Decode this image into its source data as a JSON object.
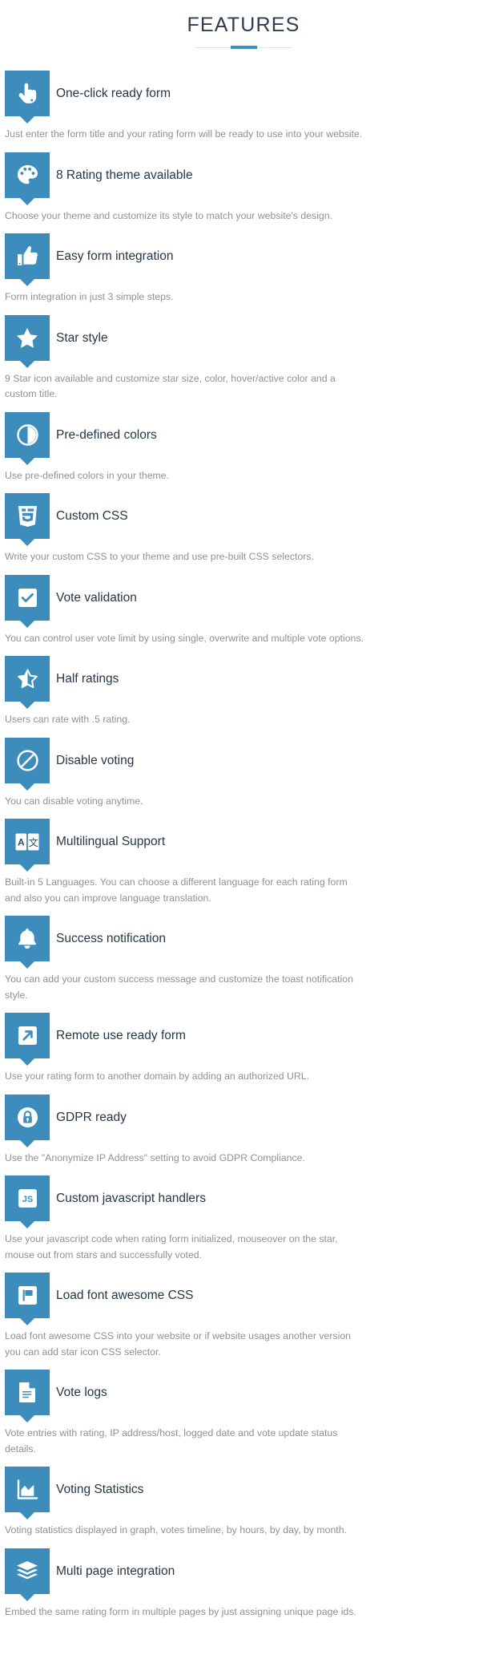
{
  "header": {
    "title": "FEATURES",
    "accent_color": "#3d8fbf",
    "divider_color": "#e2e2e2"
  },
  "theme": {
    "badge_color": "#3c8dbc",
    "title_color": "#253746",
    "description_color": "#8f9193"
  },
  "features": [
    {
      "icon": "hand-pointer-icon",
      "title": "One-click ready form",
      "description": "Just enter the form title and your rating form will be ready to use into your website."
    },
    {
      "icon": "palette-icon",
      "title": "8 Rating theme available",
      "description": "Choose your theme and customize its style to match your website's design."
    },
    {
      "icon": "thumbs-up-icon",
      "title": "Easy form integration",
      "description": "Form integration in just 3 simple steps."
    },
    {
      "icon": "star-icon",
      "title": "Star style",
      "description": "9 Star icon available and customize star size, color, hover/active color and a custom title."
    },
    {
      "icon": "half-circle-contrast-icon",
      "title": "Pre-defined colors",
      "description": "Use pre-defined colors in your theme."
    },
    {
      "icon": "css3-shield-icon",
      "title": "Custom CSS",
      "description": "Write your custom CSS to your theme and use pre-built CSS selectors."
    },
    {
      "icon": "checkbox-check-icon",
      "title": "Vote validation",
      "description": "You can control user vote limit by using single, overwrite and multiple vote options."
    },
    {
      "icon": "star-half-icon",
      "title": "Half ratings",
      "description": "Users can rate with .5 rating."
    },
    {
      "icon": "ban-icon",
      "title": "Disable voting",
      "description": "You can disable voting anytime."
    },
    {
      "icon": "language-translate-icon",
      "title": "Multilingual Support",
      "description": "Built-in 5 Languages. You can choose a different language for each rating form and also you can improve language translation."
    },
    {
      "icon": "bell-icon",
      "title": "Success notification",
      "description": "You can add your custom success message and customize the toast notification style."
    },
    {
      "icon": "external-link-arrow-icon",
      "title": "Remote use ready form",
      "description": "Use your rating form to another domain by adding an authorized URL."
    },
    {
      "icon": "lock-circle-icon",
      "title": "GDPR ready",
      "description": "Use the \"Anonymize IP Address\" setting to avoid GDPR Compliance."
    },
    {
      "icon": "javascript-js-icon",
      "title": "Custom javascript handlers",
      "description": "Use your javascript code when rating form initialized, mouseover on the star, mouse out from stars and successfully voted."
    },
    {
      "icon": "flag-icon",
      "title": "Load font awesome CSS",
      "description": "Load font awesome CSS into your website or if website usages another version you can add star icon CSS selector."
    },
    {
      "icon": "document-lines-icon",
      "title": "Vote logs",
      "description": "Vote entries with rating, IP address/host, logged date and vote update status details."
    },
    {
      "icon": "area-chart-icon",
      "title": "Voting Statistics",
      "description": "Voting statistics displayed in graph, votes timeline, by hours, by day, by month."
    },
    {
      "icon": "layers-stack-icon",
      "title": "Multi page integration",
      "description": "Embed the same rating form in multiple pages by just assigning unique page ids."
    }
  ]
}
